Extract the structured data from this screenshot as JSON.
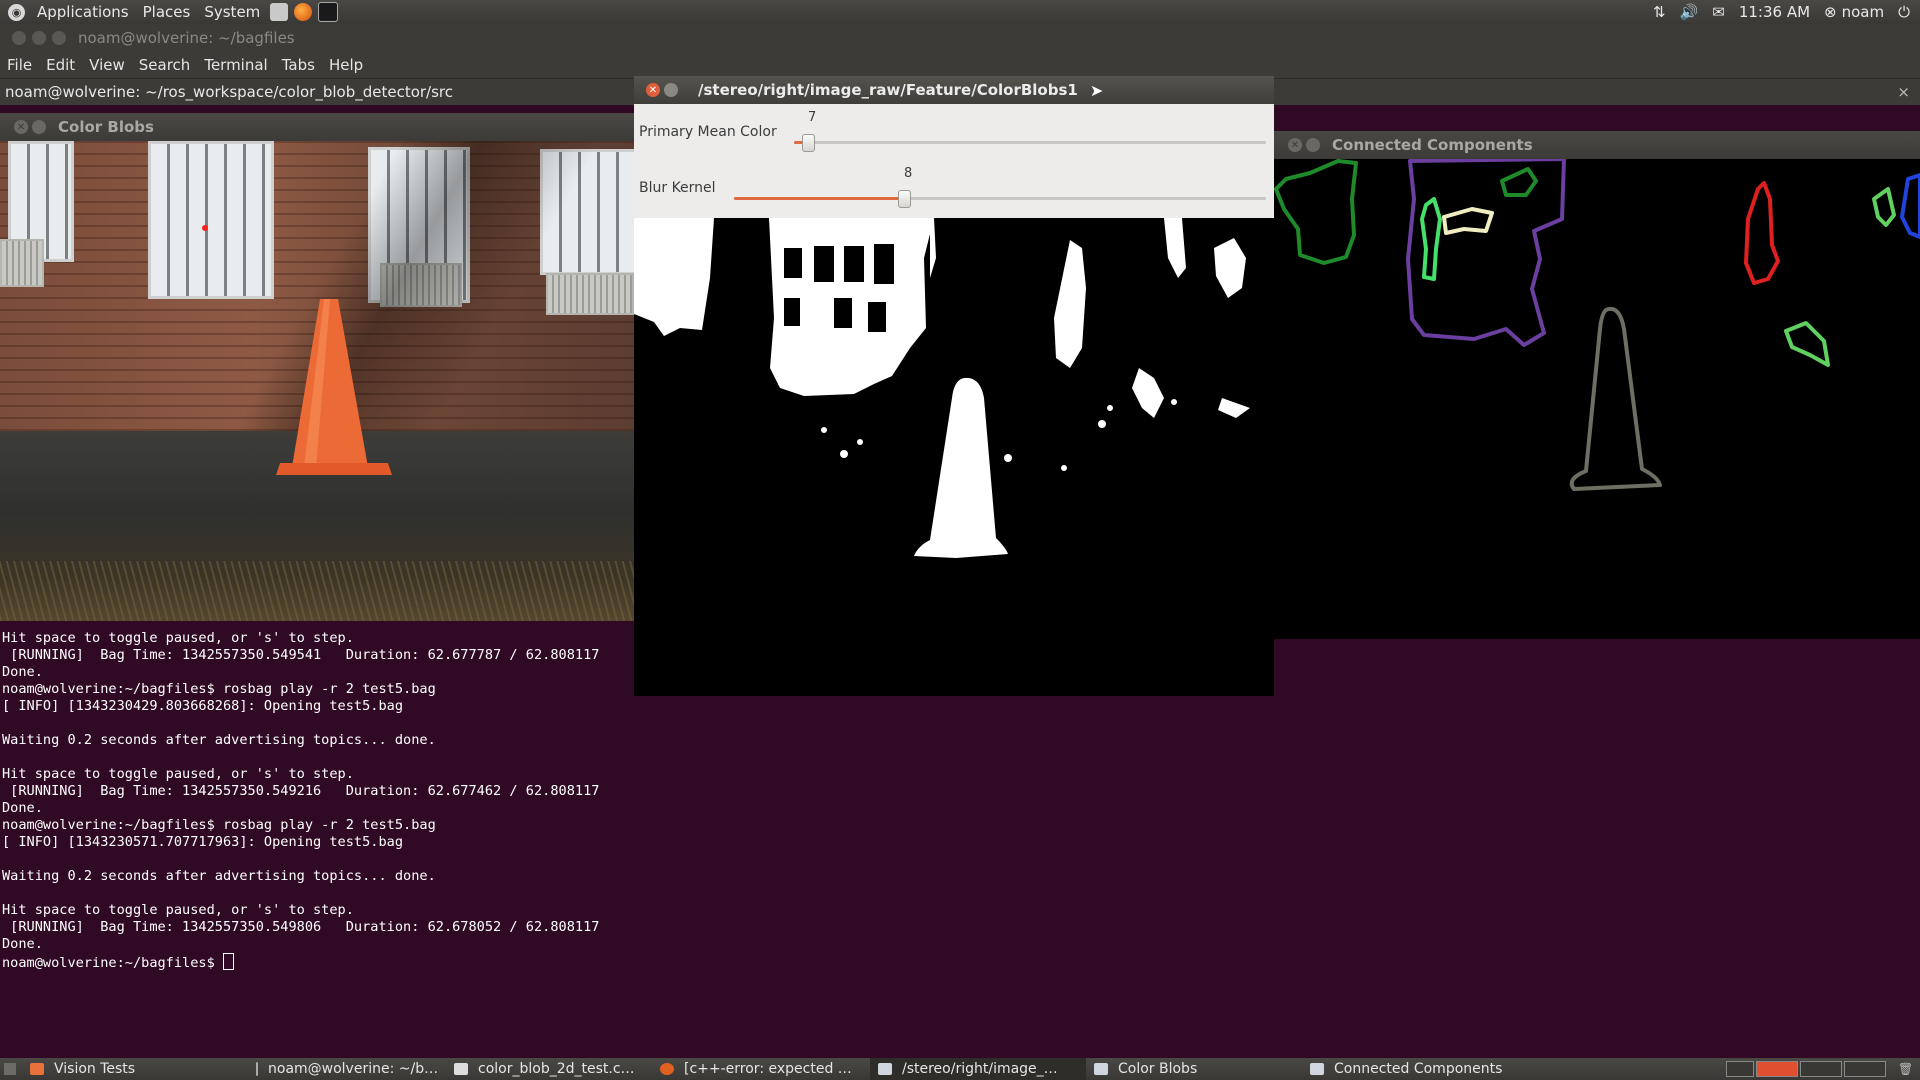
{
  "top_panel": {
    "menus": [
      "Applications",
      "Places",
      "System"
    ],
    "clock": "11:36 AM",
    "user": "noam",
    "icons": [
      "network-icon",
      "volume-icon",
      "mail-icon",
      "user-icon",
      "power-icon"
    ]
  },
  "terminal": {
    "title": "noam@wolverine: ~/bagfiles",
    "menu": [
      "File",
      "Edit",
      "View",
      "Search",
      "Terminal",
      "Tabs",
      "Help"
    ],
    "tab_title": "noam@wolverine: ~/ros_workspace/color_blob_detector/src",
    "tab_close": "×",
    "output": "Hit space to toggle paused, or 's' to step.\n [RUNNING]  Bag Time: 1342557350.549541   Duration: 62.677787 / 62.808117\nDone.\nnoam@wolverine:~/bagfiles$ rosbag play -r 2 test5.bag\n[ INFO] [1343230429.803668268]: Opening test5.bag\n\nWaiting 0.2 seconds after advertising topics... done.\n\nHit space to toggle paused, or 's' to step.\n [RUNNING]  Bag Time: 1342557350.549216   Duration: 62.677462 / 62.808117\nDone.\nnoam@wolverine:~/bagfiles$ rosbag play -r 2 test5.bag\n[ INFO] [1343230571.707717963]: Opening test5.bag\n\nWaiting 0.2 seconds after advertising topics... done.\n\nHit space to toggle paused, or 's' to step.\n [RUNNING]  Bag Time: 1342557350.549806   Duration: 62.678052 / 62.808117\nDone.\nnoam@wolverine:~/bagfiles$ "
  },
  "color_blobs_window": {
    "title": "Color Blobs"
  },
  "blobs1_window": {
    "title": "/stereo/right/image_raw/Feature/ColorBlobs1",
    "sliders": [
      {
        "label": "Primary Mean Color",
        "value": "7",
        "fraction": 0.03
      },
      {
        "label": "Blur Kernel",
        "value": "8",
        "fraction": 0.32
      }
    ]
  },
  "cc_window": {
    "title": "Connected Components",
    "contour_colors": [
      "#1f8a2a",
      "#6a3fa0",
      "#44e06a",
      "#f0eec0",
      "#e02020",
      "#60d060",
      "#2244dd",
      "#6e6e62"
    ]
  },
  "taskbar": {
    "items": [
      {
        "label": "Vision Tests",
        "icon": "folder-icon"
      },
      {
        "label": "noam@wolverine: ~/b…",
        "icon": "terminal-icon"
      },
      {
        "label": "color_blob_2d_test.c…",
        "icon": "editor-icon"
      },
      {
        "label": "[c++-error: expected …",
        "icon": "firefox-icon"
      },
      {
        "label": "/stereo/right/image_…",
        "icon": "window-icon"
      },
      {
        "label": "Color Blobs",
        "icon": "window-icon"
      },
      {
        "label": "Connected Components",
        "icon": "window-icon"
      }
    ]
  }
}
